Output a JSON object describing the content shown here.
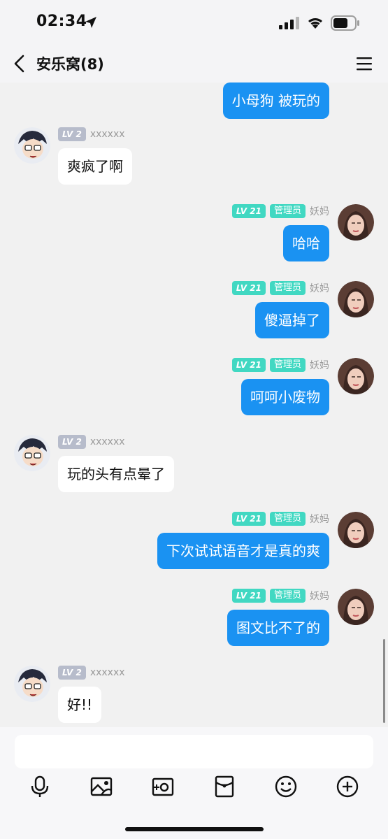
{
  "status_bar": {
    "time": "02:34"
  },
  "nav": {
    "title": "安乐窝(8)"
  },
  "messages": [
    {
      "side": "right",
      "level": "",
      "admin": "",
      "name": "",
      "text": "小母狗 被玩的"
    },
    {
      "side": "left",
      "level": "LV 2",
      "admin": "",
      "name": "xxxxxx",
      "text": "爽疯了啊"
    },
    {
      "side": "right",
      "level": "LV 21",
      "admin": "管理员",
      "name": "妖妈",
      "text": "哈哈"
    },
    {
      "side": "right",
      "level": "LV 21",
      "admin": "管理员",
      "name": "妖妈",
      "text": "傻逼掉了"
    },
    {
      "side": "right",
      "level": "LV 21",
      "admin": "管理员",
      "name": "妖妈",
      "text": "呵呵小废物"
    },
    {
      "side": "left",
      "level": "LV 2",
      "admin": "",
      "name": "xxxxxx",
      "text": "玩的头有点晕了"
    },
    {
      "side": "right",
      "level": "LV 21",
      "admin": "管理员",
      "name": "妖妈",
      "text": "下次试试语音才是真的爽"
    },
    {
      "side": "right",
      "level": "LV 21",
      "admin": "管理员",
      "name": "妖妈",
      "text": "图文比不了的"
    },
    {
      "side": "left",
      "level": "LV 2",
      "admin": "",
      "name": "xxxxxx",
      "text": "好!!"
    }
  ],
  "input": {
    "value": "",
    "placeholder": ""
  },
  "toolbar": [
    "microphone-icon",
    "image-icon",
    "camera-icon",
    "red-packet-icon",
    "emoji-icon",
    "plus-icon"
  ],
  "colors": {
    "bubble_self": "#1a92f2",
    "level_badge": "#41d8c2",
    "level_badge_gray": "#b7bccb",
    "background": "#f1f1f1"
  }
}
